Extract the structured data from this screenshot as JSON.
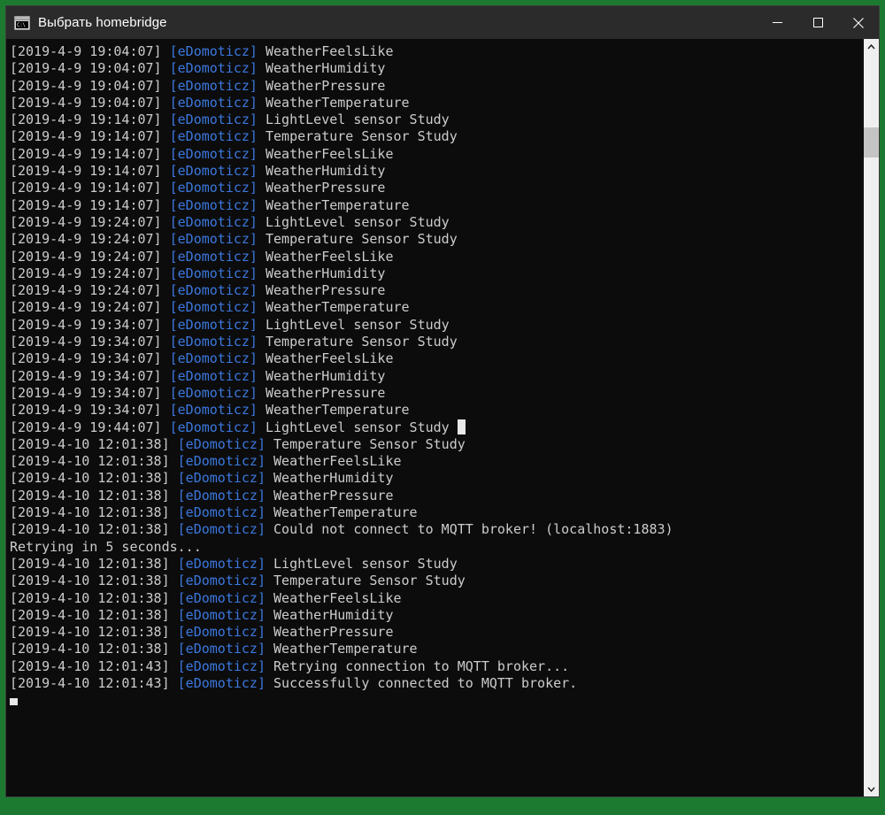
{
  "window": {
    "title": "Выбрать homebridge",
    "icon": "console-icon",
    "icon_glyph": "C:\\",
    "accent_border_color": "#1b7a30",
    "titlebar_color": "#2b2b2b",
    "console_background": "#0c0c0c",
    "controls": {
      "minimize_label": "Свернуть",
      "maximize_label": "Развернуть",
      "close_label": "Закрыть"
    }
  },
  "console": {
    "foreground_color": "#cccccc",
    "tag_color": "#3b78de",
    "font_size_px": 15,
    "lines": [
      {
        "ts": "[2019-4-9 19:04:07] ",
        "tag": "[eDomoticz]",
        "msg": " WeatherFeelsLike"
      },
      {
        "ts": "[2019-4-9 19:04:07] ",
        "tag": "[eDomoticz]",
        "msg": " WeatherHumidity"
      },
      {
        "ts": "[2019-4-9 19:04:07] ",
        "tag": "[eDomoticz]",
        "msg": " WeatherPressure"
      },
      {
        "ts": "[2019-4-9 19:04:07] ",
        "tag": "[eDomoticz]",
        "msg": " WeatherTemperature"
      },
      {
        "ts": "[2019-4-9 19:14:07] ",
        "tag": "[eDomoticz]",
        "msg": " LightLevel sensor Study"
      },
      {
        "ts": "[2019-4-9 19:14:07] ",
        "tag": "[eDomoticz]",
        "msg": " Temperature Sensor Study"
      },
      {
        "ts": "[2019-4-9 19:14:07] ",
        "tag": "[eDomoticz]",
        "msg": " WeatherFeelsLike"
      },
      {
        "ts": "[2019-4-9 19:14:07] ",
        "tag": "[eDomoticz]",
        "msg": " WeatherHumidity"
      },
      {
        "ts": "[2019-4-9 19:14:07] ",
        "tag": "[eDomoticz]",
        "msg": " WeatherPressure"
      },
      {
        "ts": "[2019-4-9 19:14:07] ",
        "tag": "[eDomoticz]",
        "msg": " WeatherTemperature"
      },
      {
        "ts": "[2019-4-9 19:24:07] ",
        "tag": "[eDomoticz]",
        "msg": " LightLevel sensor Study"
      },
      {
        "ts": "[2019-4-9 19:24:07] ",
        "tag": "[eDomoticz]",
        "msg": " Temperature Sensor Study"
      },
      {
        "ts": "[2019-4-9 19:24:07] ",
        "tag": "[eDomoticz]",
        "msg": " WeatherFeelsLike"
      },
      {
        "ts": "[2019-4-9 19:24:07] ",
        "tag": "[eDomoticz]",
        "msg": " WeatherHumidity"
      },
      {
        "ts": "[2019-4-9 19:24:07] ",
        "tag": "[eDomoticz]",
        "msg": " WeatherPressure"
      },
      {
        "ts": "[2019-4-9 19:24:07] ",
        "tag": "[eDomoticz]",
        "msg": " WeatherTemperature"
      },
      {
        "ts": "[2019-4-9 19:34:07] ",
        "tag": "[eDomoticz]",
        "msg": " LightLevel sensor Study"
      },
      {
        "ts": "[2019-4-9 19:34:07] ",
        "tag": "[eDomoticz]",
        "msg": " Temperature Sensor Study"
      },
      {
        "ts": "[2019-4-9 19:34:07] ",
        "tag": "[eDomoticz]",
        "msg": " WeatherFeelsLike"
      },
      {
        "ts": "[2019-4-9 19:34:07] ",
        "tag": "[eDomoticz]",
        "msg": " WeatherHumidity"
      },
      {
        "ts": "[2019-4-9 19:34:07] ",
        "tag": "[eDomoticz]",
        "msg": " WeatherPressure"
      },
      {
        "ts": "[2019-4-9 19:34:07] ",
        "tag": "[eDomoticz]",
        "msg": " WeatherTemperature"
      },
      {
        "ts": "[2019-4-9 19:44:07] ",
        "tag": "[eDomoticz]",
        "msg": " LightLevel sensor Study ",
        "cursor": "block"
      },
      {
        "ts": "[2019-4-10 12:01:38] ",
        "tag": "[eDomoticz]",
        "msg": " Temperature Sensor Study"
      },
      {
        "ts": "[2019-4-10 12:01:38] ",
        "tag": "[eDomoticz]",
        "msg": " WeatherFeelsLike"
      },
      {
        "ts": "[2019-4-10 12:01:38] ",
        "tag": "[eDomoticz]",
        "msg": " WeatherHumidity"
      },
      {
        "ts": "[2019-4-10 12:01:38] ",
        "tag": "[eDomoticz]",
        "msg": " WeatherPressure"
      },
      {
        "ts": "[2019-4-10 12:01:38] ",
        "tag": "[eDomoticz]",
        "msg": " WeatherTemperature"
      },
      {
        "ts": "[2019-4-10 12:01:38] ",
        "tag": "[eDomoticz]",
        "msg": " Could not connect to MQTT broker! (localhost:1883)"
      },
      {
        "ts": "",
        "tag": "",
        "msg": "Retrying in 5 seconds..."
      },
      {
        "ts": "[2019-4-10 12:01:38] ",
        "tag": "[eDomoticz]",
        "msg": " LightLevel sensor Study"
      },
      {
        "ts": "[2019-4-10 12:01:38] ",
        "tag": "[eDomoticz]",
        "msg": " Temperature Sensor Study"
      },
      {
        "ts": "[2019-4-10 12:01:38] ",
        "tag": "[eDomoticz]",
        "msg": " WeatherFeelsLike"
      },
      {
        "ts": "[2019-4-10 12:01:38] ",
        "tag": "[eDomoticz]",
        "msg": " WeatherHumidity"
      },
      {
        "ts": "[2019-4-10 12:01:38] ",
        "tag": "[eDomoticz]",
        "msg": " WeatherPressure"
      },
      {
        "ts": "[2019-4-10 12:01:38] ",
        "tag": "[eDomoticz]",
        "msg": " WeatherTemperature"
      },
      {
        "ts": "[2019-4-10 12:01:43] ",
        "tag": "[eDomoticz]",
        "msg": " Retrying connection to MQTT broker..."
      },
      {
        "ts": "[2019-4-10 12:01:43] ",
        "tag": "[eDomoticz]",
        "msg": " Successfully connected to MQTT broker."
      },
      {
        "ts": "",
        "tag": "",
        "msg": "",
        "cursor": "underline"
      }
    ]
  },
  "scrollbar": {
    "up_arrow": "scroll-up",
    "down_arrow": "scroll-down",
    "track_color": "#efefef",
    "thumb_color": "#c4c4c4"
  }
}
